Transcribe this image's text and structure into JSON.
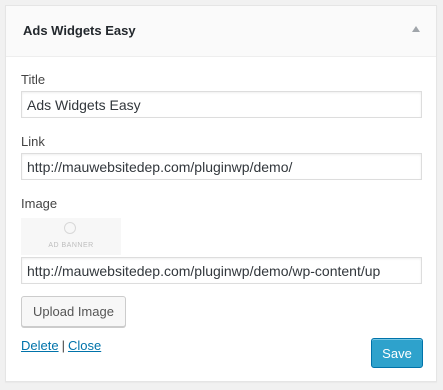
{
  "widget": {
    "title": "Ads Widgets Easy"
  },
  "fields": {
    "title_label": "Title",
    "title_value": "Ads Widgets Easy",
    "link_label": "Link",
    "link_value": "http://mauwebsitedep.com/pluginwp/demo/",
    "image_label": "Image",
    "image_preview_text": "AD BANNER",
    "image_url_value": "http://mauwebsitedep.com/pluginwp/demo/wp-content/up"
  },
  "actions": {
    "upload_label": "Upload Image",
    "delete_label": "Delete",
    "separator": "|",
    "close_label": "Close",
    "save_label": "Save"
  },
  "colors": {
    "link": "#0073aa",
    "primary_button": "#2ea2cc",
    "background": "#f1f1f1"
  }
}
